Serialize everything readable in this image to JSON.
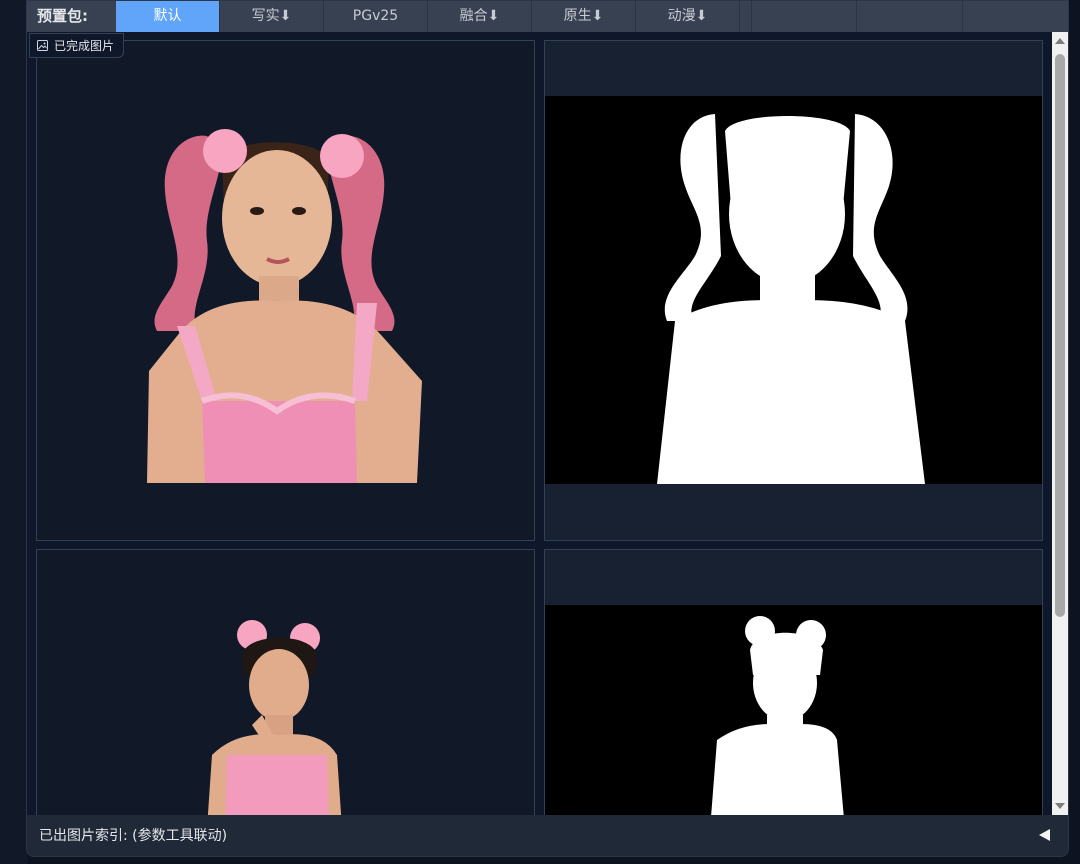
{
  "tabbar": {
    "label": "预置包:",
    "tabs": [
      {
        "label": "默认",
        "active": true
      },
      {
        "label": "写实⬇",
        "active": false
      },
      {
        "label": "PGv25",
        "active": false
      },
      {
        "label": "融合⬇",
        "active": false
      },
      {
        "label": "原生⬇",
        "active": false
      },
      {
        "label": "动漫⬇",
        "active": false
      },
      {
        "label": "",
        "active": false
      },
      {
        "label": "",
        "active": false
      },
      {
        "label": "",
        "active": false
      }
    ],
    "active_color": "#60a5fa"
  },
  "gallery": {
    "badge": {
      "icon": "image-icon",
      "label": "已完成图片"
    },
    "images": [
      {
        "kind": "photo",
        "subject": "girl with pink pigtails"
      },
      {
        "kind": "mask",
        "subject": "white silhouette mask of girl with pigtails"
      },
      {
        "kind": "photo",
        "subject": "girl with pink flower hair buns"
      },
      {
        "kind": "mask",
        "subject": "white silhouette mask of girl with buns"
      }
    ]
  },
  "footer": {
    "label": "已出图片索引: (参数工具联动)",
    "toggle_icon": "collapse-left-icon"
  }
}
